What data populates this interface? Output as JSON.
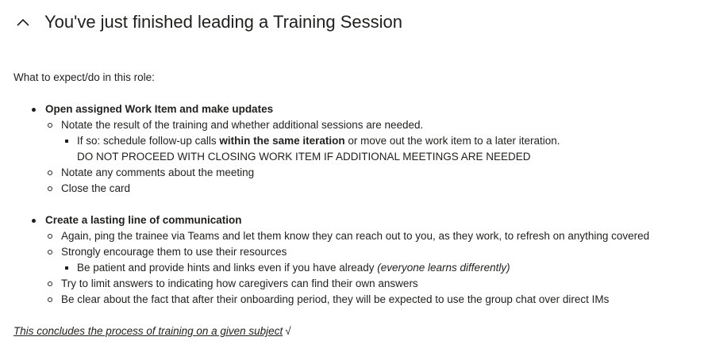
{
  "header": {
    "title": "You've just finished leading a Training Session",
    "collapse_icon": "chevron-up-icon"
  },
  "intro": "What to expect/do in this role:",
  "sections": [
    {
      "heading": "Open assigned Work Item and make updates",
      "items": [
        {
          "text": "Notate the result of the training and whether additional sessions are needed.",
          "sub": {
            "prefix": "If so: schedule follow-up calls ",
            "bold": "within the same iteration",
            "suffix": " or move out the work item to a later iteration.",
            "line2": "DO NOT PROCEED WITH CLOSING WORK ITEM IF ADDITIONAL MEETINGS ARE NEEDED"
          }
        },
        {
          "text": "Notate any comments about the meeting"
        },
        {
          "text": "Close the card"
        }
      ]
    },
    {
      "heading": "Create a lasting line of communication",
      "items": [
        {
          "text": "Again, ping the trainee via Teams and let them know they can reach out to you, as they work, to refresh on anything covered"
        },
        {
          "text": "Strongly encourage them to use their resources",
          "sub": {
            "prefix": "Be patient and provide hints and links even if you have already ",
            "italic": "(everyone learns differently)"
          }
        },
        {
          "text": "Try to limit answers to indicating how caregivers can find their own answers"
        },
        {
          "text": "Be clear about the fact that after their onboarding period, they will be expected to use the group chat over direct IMs"
        }
      ]
    }
  ],
  "footer": {
    "text": "This concludes the process of training on a given subject",
    "check": "√"
  }
}
